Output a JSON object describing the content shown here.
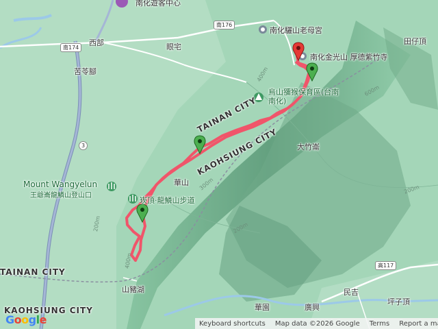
{
  "labels": {
    "nanhua_visitor_center": "南化遊客中心",
    "road_176": "南176",
    "lishan_temple": "南化驪山老母宮",
    "jinguang_temple": "南化金光山 厚德紫竹寺",
    "tianzi_ding": "田仔頂",
    "road_174": "南174",
    "xibu": "西部",
    "yanzhai": "眼宅",
    "kuling_jiao": "苦苓腳",
    "highway_3": "3",
    "macaque_center": "烏山獼猴保育區(台南南化)",
    "dazhu_qi": "大竹崙",
    "tainan_city_line": "TAINAN CITY",
    "kaohsiung_city_line": "KAOHSIUNG CITY",
    "mount_wangyelun": "Mount Wangyelun",
    "wangyelun_trailhead": "王爺崙龍鱗山登山口",
    "trail_name": "崁頂·龍鱗山步道",
    "huashan": "華山",
    "shanzhu_hu": "山豬湖",
    "road_117": "高117",
    "minji": "民吉",
    "pingzi_ding": "坪子頂",
    "huayuan": "華園",
    "guangxing": "廣興",
    "tainan_city_bottom": "TAINAN CITY",
    "kaohsiung_city_bottom": "KAOHSIUNG CITY",
    "contour_400": "400m",
    "contour_300": "300m",
    "contour_200a": "200m",
    "contour_200b": "200m",
    "contour_200c": "200m",
    "contour_600": "600m",
    "contour_400b": "400m"
  },
  "attribution": {
    "keyboard": "Keyboard shortcuts",
    "map_data": "Map data ©2026 Google",
    "terms": "Terms",
    "report": "Report a map error"
  },
  "logo": "Google",
  "colors": {
    "track": "#f0556a",
    "marker_start": "#e53935",
    "waypoint": "#4caf50",
    "terrain": "#9fd3b4"
  }
}
